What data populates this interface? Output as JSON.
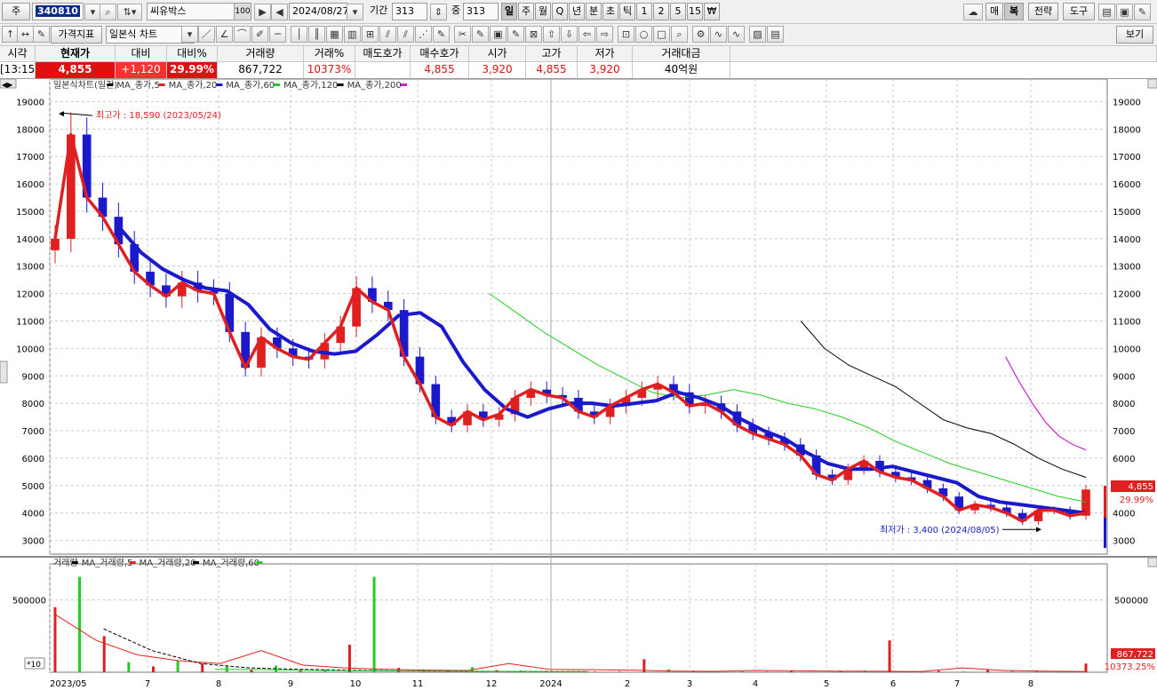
{
  "toolbar": {
    "market": "주",
    "code": "340810",
    "name": "씨유박스",
    "name_badge": "100",
    "date": "2024/08/27",
    "period_label": "기간",
    "period_value": "313",
    "count_value": "313",
    "count_label": "중",
    "timeframes": [
      "일",
      "주",
      "월",
      "Q",
      "년",
      "분",
      "초",
      "틱",
      "1",
      "2",
      "5",
      "15",
      "₩"
    ],
    "active_timeframe": "일",
    "right_buttons": [
      "매",
      "복",
      "전략",
      "도구"
    ],
    "indicator_btn": "가격지표",
    "chart_type": "일본식 차트",
    "view_btn": "보기"
  },
  "quote": {
    "headers": [
      "시각",
      "현재가",
      "대비",
      "대비%",
      "거래량",
      "거래%",
      "매도호가",
      "매수호가",
      "시가",
      "고가",
      "저가",
      "거래대금"
    ],
    "values": [
      "[13:15]",
      "4,855",
      "+1,120",
      "29.99%",
      "867,722",
      "10373%",
      "",
      "4,855",
      "3,920",
      "4,855",
      "3,920",
      "40억원"
    ]
  },
  "legend": {
    "price": [
      "일본식차트(일간)",
      "MA_종가,5",
      "MA_종가,20",
      "MA_종가,60",
      "MA_종가,120",
      "MA_종가,200"
    ],
    "volume": [
      "거래량",
      "MA_거래량,5",
      "MA_거래량,20",
      "MA_거래량,60"
    ]
  },
  "annotations": {
    "high": "최고가 : 18,590 (2023/05/24)",
    "low": "최저가 : 3,400 (2024/08/05)",
    "x10": "*10"
  },
  "colors": {
    "up": "#e02020",
    "down": "#1a1acc",
    "ma5": "#e02020",
    "ma20": "#1a1acc",
    "ma60": "#22cc22",
    "ma120": "#000000",
    "ma200": "#cc22cc"
  },
  "chart_data": {
    "type": "candlestick",
    "x_ticks": [
      "2023/05",
      "7",
      "8",
      "9",
      "10",
      "11",
      "12",
      "2024",
      "2",
      "3",
      "4",
      "5",
      "6",
      "7",
      "8"
    ],
    "price_ticks": [
      3000,
      4000,
      5000,
      6000,
      7000,
      8000,
      9000,
      10000,
      11000,
      12000,
      13000,
      14000,
      15000,
      16000,
      17000,
      18000,
      19000
    ],
    "ylim": [
      2500,
      19500
    ],
    "volume_ticks": [
      500000
    ],
    "volume_ylim": [
      0,
      700000
    ],
    "last_price": "4,855",
    "last_change_pct": "29.99%",
    "last_volume": "867,722",
    "last_volume_pct": "10373.25%",
    "series": [
      {
        "name": "일본식차트(일간)",
        "role": "close",
        "values": [
          14000,
          17800,
          15500,
          14800,
          13800,
          12800,
          12300,
          11900,
          12400,
          12100,
          12000,
          10600,
          9300,
          10400,
          10000,
          9700,
          9600,
          10200,
          10800,
          12200,
          11700,
          11400,
          9700,
          8700,
          7500,
          7200,
          7700,
          7400,
          7600,
          8200,
          8500,
          8300,
          8200,
          7700,
          7500,
          7900,
          8200,
          8500,
          8700,
          8400,
          7900,
          8000,
          7700,
          7200,
          6900,
          6700,
          6500,
          6100,
          5400,
          5200,
          5600,
          5900,
          5500,
          5300,
          5200,
          4900,
          4600,
          4100,
          4300,
          4200,
          4000,
          3700,
          4100,
          4100,
          3900,
          4855
        ]
      },
      {
        "name": "MA_종가,5",
        "values": [
          14000,
          17800,
          15500,
          14800,
          13800,
          12800,
          12300,
          11900,
          12400,
          12100,
          12000,
          10600,
          9300,
          10400,
          10000,
          9700,
          9600,
          10200,
          10800,
          12200,
          11700,
          11400,
          9700,
          8700,
          7500,
          7200,
          7700,
          7400,
          7600,
          8200,
          8500,
          8300,
          8200,
          7700,
          7500,
          7900,
          8200,
          8500,
          8700,
          8400,
          7900,
          8000,
          7700,
          7200,
          6900,
          6700,
          6500,
          6100,
          5400,
          5200,
          5600,
          5900,
          5500,
          5300,
          5200,
          4900,
          4600,
          4100,
          4300,
          4200,
          4000,
          3700,
          4100,
          4100,
          3900,
          4000
        ]
      },
      {
        "name": "MA_종가,20",
        "values": [
          null,
          null,
          null,
          14400,
          13500,
          12900,
          12500,
          12200,
          12100,
          11600,
          10700,
          10200,
          9900,
          9800,
          9900,
          10500,
          11200,
          11300,
          10800,
          9500,
          8500,
          7800,
          7500,
          7800,
          8000,
          8000,
          7900,
          8000,
          8100,
          8400,
          8200,
          7900,
          7400,
          7000,
          6700,
          6200,
          5800,
          5600,
          5600,
          5700,
          5500,
          5300,
          5100,
          4600,
          4400,
          4300,
          4200,
          4100,
          4000
        ]
      },
      {
        "name": "MA_종가,60",
        "values": [
          null,
          null,
          null,
          null,
          null,
          null,
          null,
          null,
          null,
          12000,
          11300,
          10600,
          10000,
          9400,
          8900,
          8400,
          8200,
          8300,
          8500,
          8300,
          8000,
          7800,
          7500,
          7100,
          6600,
          6200,
          5800,
          5500,
          5200,
          4900,
          4600,
          4400
        ]
      },
      {
        "name": "MA_종가,120",
        "values": [
          null,
          null,
          null,
          null,
          null,
          null,
          null,
          null,
          null,
          null,
          null,
          null,
          null,
          null,
          null,
          11000,
          10000,
          9400,
          9000,
          8600,
          8000,
          7400,
          7100,
          6900,
          6500,
          6000,
          5600,
          5300
        ]
      },
      {
        "name": "MA_종가,200",
        "values": [
          null,
          null,
          null,
          null,
          null,
          null,
          null,
          null,
          null,
          null,
          null,
          null,
          null,
          null,
          null,
          null,
          null,
          null,
          null,
          null,
          null,
          null,
          9700,
          8800,
          8000,
          7300,
          6800,
          6500,
          6300
        ]
      },
      {
        "name": "거래량",
        "values": [
          450000,
          660000,
          250000,
          70000,
          40000,
          80000,
          60000,
          40000,
          20000,
          45000,
          10000,
          20000,
          190000,
          660000,
          30000,
          20000,
          12000,
          35000,
          15000,
          12000,
          10000,
          8000,
          5000,
          8000,
          90000,
          20000,
          10000,
          8000,
          5000,
          6000,
          8000,
          5000,
          6000,
          12000,
          220000,
          8000,
          10000,
          6000,
          15000,
          8000,
          5000,
          7000,
          60000
        ]
      },
      {
        "name": "MA_거래량,5",
        "values": [
          400000,
          220000,
          120000,
          80000,
          60000,
          150000,
          50000,
          30000,
          20000,
          15000,
          12000,
          60000,
          20000,
          18000,
          15000,
          8000,
          6000,
          12000,
          10000,
          8000,
          7000,
          5000,
          30000,
          12000,
          8000,
          5000
        ]
      },
      {
        "name": "MA_거래량,20",
        "values": [
          null,
          300000,
          150000,
          60000,
          30000,
          20000,
          15000,
          10000,
          8000,
          6000,
          5000,
          4000
        ]
      },
      {
        "name": "MA_거래량,60",
        "values": [
          null,
          null,
          null,
          20000,
          18000,
          12000,
          10000,
          8000,
          7000,
          5000,
          4000
        ]
      }
    ]
  }
}
